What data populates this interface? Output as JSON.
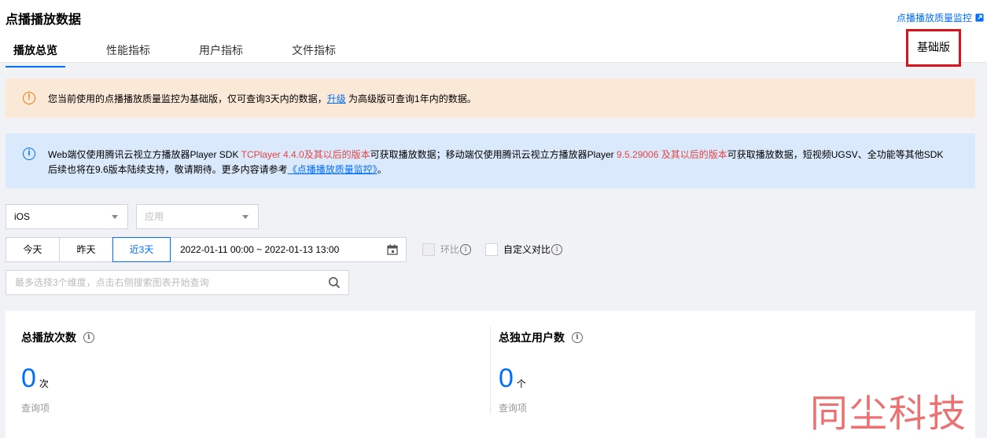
{
  "header": {
    "title": "点播播放数据",
    "quality_link": "点播播放质量监控",
    "edition_badge": "基础版"
  },
  "tabs": [
    {
      "label": "播放总览",
      "active": true
    },
    {
      "label": "性能指标",
      "active": false
    },
    {
      "label": "用户指标",
      "active": false
    },
    {
      "label": "文件指标",
      "active": false
    }
  ],
  "alerts": {
    "warning": {
      "text_before": "您当前使用的点播播放质量监控为基础版，仅可查询3天内的数据，",
      "link": "升级",
      "text_after": " 为高级版可查询1年内的数据。"
    },
    "info": {
      "part1": "Web端仅使用腾讯云视立方播放器Player SDK ",
      "part2_red": "TCPlayer 4.4.0及其以后的版本",
      "part3": "可获取播放数据；移动端仅使用腾讯云视立方播放器Player ",
      "part4_red": "9.5.29006 及其以后的版本",
      "part5": "可获取播放数据，短视频UGSV、全功能等其他SDK后续也将在9.6版本陆续支持，敬请期待。更多内容请参考",
      "link": "《点播播放质量监控》",
      "end": "。"
    }
  },
  "filters": {
    "os_select": "iOS",
    "app_placeholder": "应用",
    "date_buttons": {
      "today": "今天",
      "yesterday": "昨天",
      "last3": "近3天"
    },
    "date_range": "2022-01-11 00:00 ~ 2022-01-13 13:00",
    "compare_mom": "环比",
    "compare_custom": "自定义对比",
    "search_placeholder": "最多选择3个维度，点击右侧搜索图表开始查询"
  },
  "stats": [
    {
      "label": "总播放次数",
      "value": "0",
      "unit": "次",
      "sub": "查询项"
    },
    {
      "label": "总独立用户数",
      "value": "0",
      "unit": "个",
      "sub": "查询项"
    }
  ],
  "watermark": "同尘科技",
  "colors": {
    "accent": "#006eff",
    "warning_bg": "#fbe9d8",
    "info_bg": "#dae9fc",
    "highlight_red": "#e54545",
    "badge_border": "#d8131b"
  },
  "icons": [
    "external-link-icon",
    "warning-icon",
    "info-icon",
    "calendar-icon",
    "search-icon",
    "info-circle-icon",
    "caret-down-icon"
  ]
}
